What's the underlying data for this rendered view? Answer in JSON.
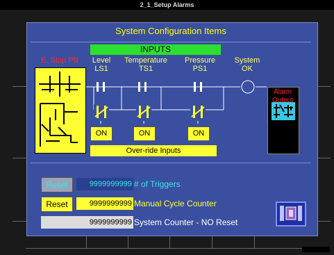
{
  "window": {
    "title": "2_1_Setup Alarms"
  },
  "panel": {
    "title": "System Configuration Items",
    "inputs_header": "INPUTS",
    "estop_label": "E. Stop PB",
    "columns": [
      {
        "name": "Level",
        "tag": "LS1"
      },
      {
        "name": "Temperature",
        "tag": "TS1"
      },
      {
        "name": "Pressure",
        "tag": "PS1"
      },
      {
        "name": "System",
        "tag": "OK"
      }
    ],
    "on_buttons": [
      "ON",
      "ON",
      "ON"
    ],
    "override_label": "Over-ride Inputs",
    "alarm_label": "Alarm Output"
  },
  "counters": [
    {
      "button": "Reset",
      "value": "9999999999",
      "label": "# of Triggers",
      "value_color": "#39e6e6",
      "label_color": "#39e6e6"
    },
    {
      "button": "Reset",
      "value": "9999999999",
      "label": "Manual Cycle Counter",
      "value_color": "#000000",
      "label_color": "#ffff33"
    },
    {
      "button": "",
      "value": "9999999999",
      "label": "System Counter  - NO Reset",
      "value_color": "#000000",
      "label_color": "#ffffff"
    }
  ],
  "colors": {
    "panel": "#3a4fa0",
    "accent": "#ffff33",
    "inputs": "#2ee02e",
    "alarm": "#ff2a2a"
  },
  "icons": {
    "logic": "ladder-logic-icon",
    "alarm": "alarm-output-icon",
    "nav": "screen-nav-icon"
  }
}
